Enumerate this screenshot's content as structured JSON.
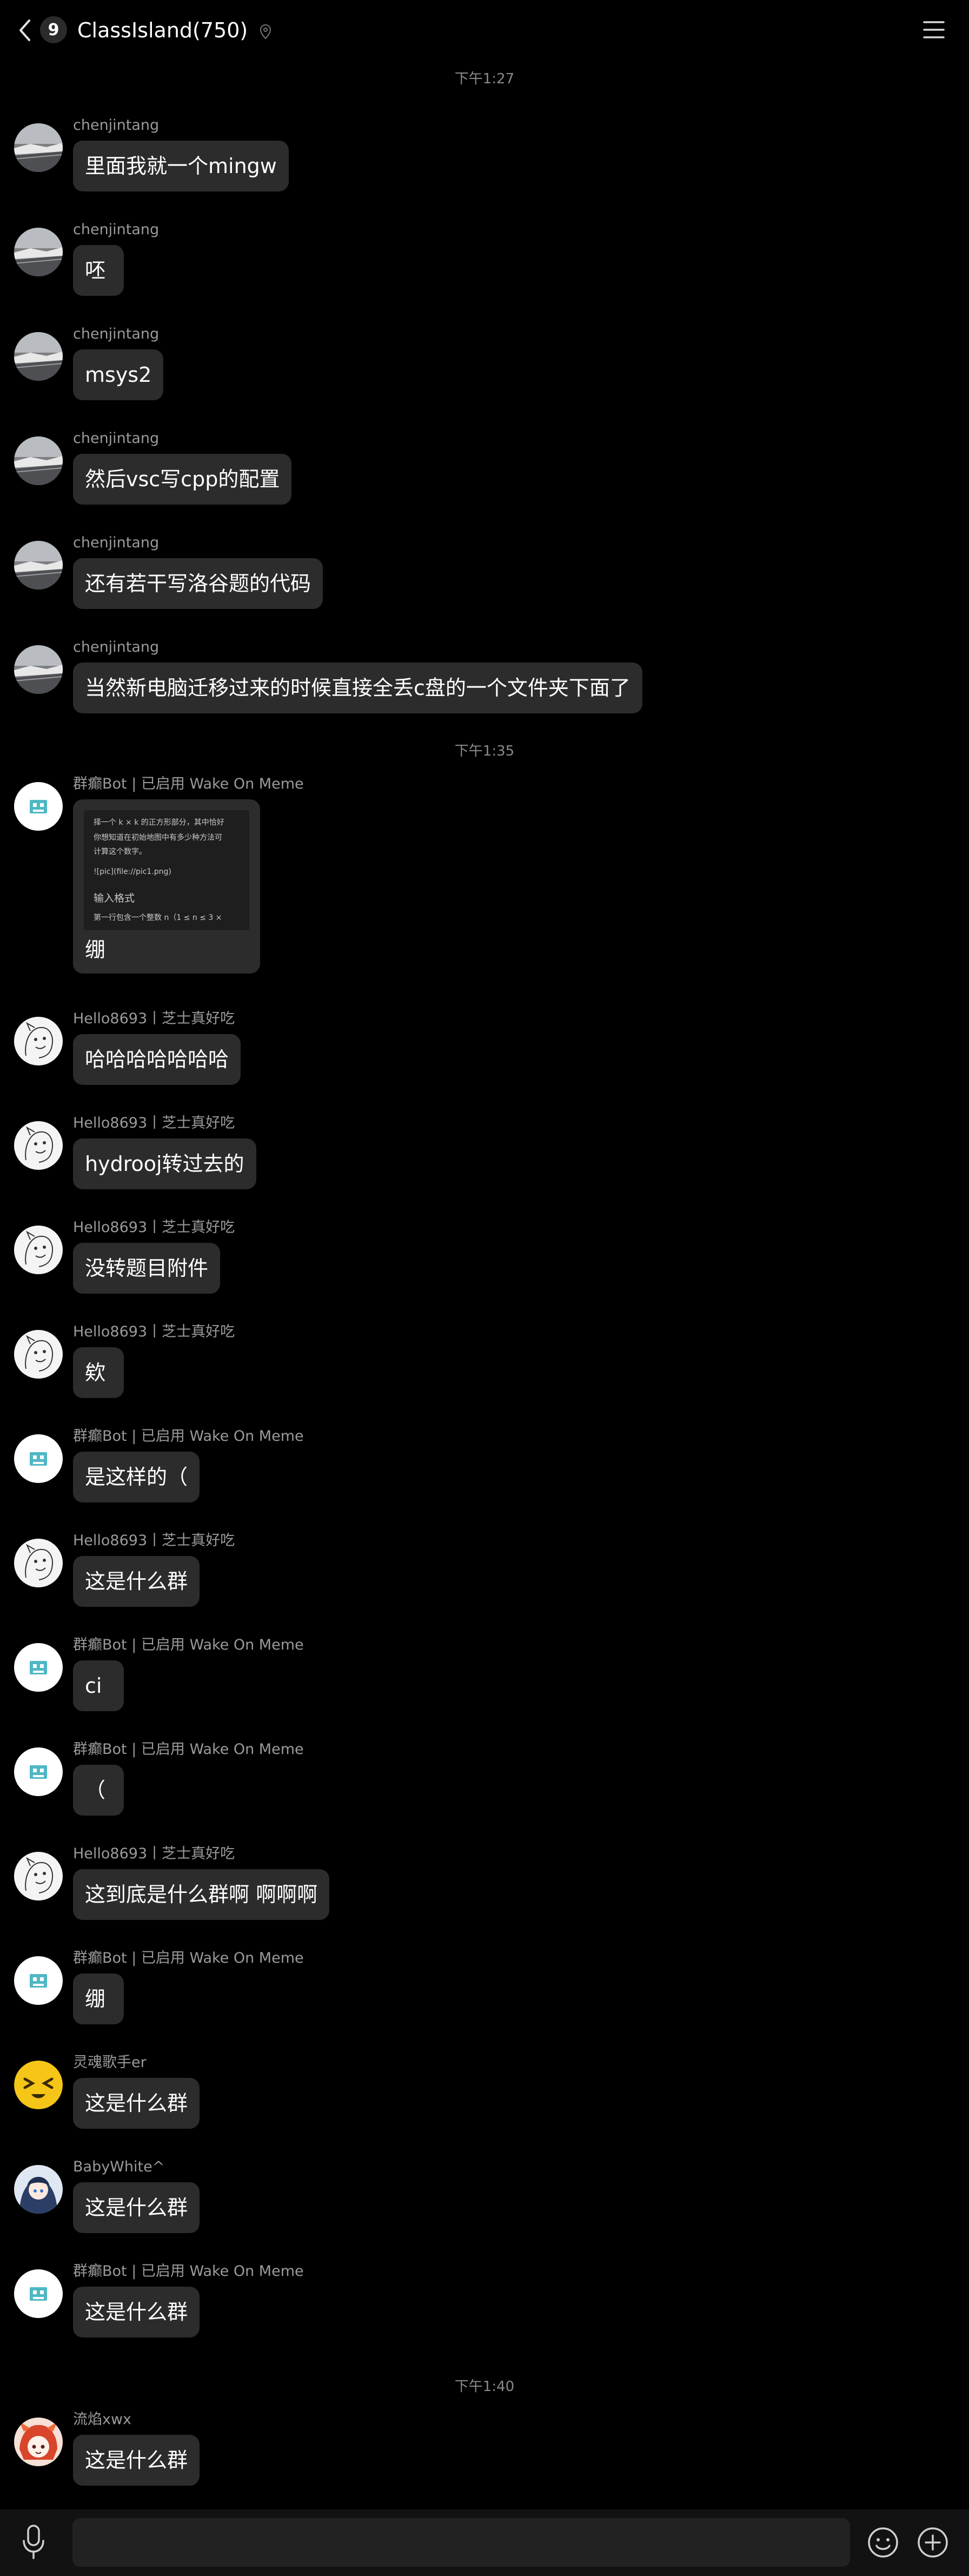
{
  "header": {
    "unread_count": "9",
    "title": "ClassIsland(750)"
  },
  "colors": {
    "background": "#000000",
    "bubble": "#2c2c2c",
    "sender_text": "#9a9a9a",
    "bot_avatar_accent": "#4fb8c4"
  },
  "chat": {
    "timestamps": [
      "下午1:27",
      "下午1:35",
      "下午1:40"
    ],
    "messages": [
      {
        "sender": "chenjintang",
        "text": "里面我就一个mingw",
        "avatar": "landscape-avatar"
      },
      {
        "sender": "chenjintang",
        "text": "呸",
        "avatar": "landscape-avatar"
      },
      {
        "sender": "chenjintang",
        "text": "msys2",
        "avatar": "landscape-avatar"
      },
      {
        "sender": "chenjintang",
        "text": "然后vsc写cpp的配置",
        "avatar": "landscape-avatar"
      },
      {
        "sender": "chenjintang",
        "text": "还有若干写洛谷题的代码",
        "avatar": "landscape-avatar"
      },
      {
        "sender": "chenjintang",
        "text": "当然新电脑迁移过来的时候直接全丢c盘的一个文件夹下面了",
        "avatar": "landscape-avatar"
      },
      {
        "sender": "群癫Bot | 已启用 Wake On Meme",
        "text": "绷",
        "avatar": "bot-avatar",
        "image": {
          "lines": [
            "择一个 k × k 的正方形部分，其中恰好",
            "你想知道在初始地图中有多少种方法可",
            "计算这个数字。",
            "![pic](file://pic1.png)",
            "输入格式",
            "第一行包含一个整数 n（1 ≤ n ≤ 3 ×"
          ]
        }
      },
      {
        "sender": "Hello8693丨芝士真好吃",
        "text": "哈哈哈哈哈哈哈",
        "avatar": "sketch-avatar"
      },
      {
        "sender": "Hello8693丨芝士真好吃",
        "text": "hydrooj转过去的",
        "avatar": "sketch-avatar"
      },
      {
        "sender": "Hello8693丨芝士真好吃",
        "text": "没转题目附件",
        "avatar": "sketch-avatar"
      },
      {
        "sender": "Hello8693丨芝士真好吃",
        "text": "欸",
        "avatar": "sketch-avatar"
      },
      {
        "sender": "群癫Bot | 已启用 Wake On Meme",
        "text": "是这样的（",
        "avatar": "bot-avatar"
      },
      {
        "sender": "Hello8693丨芝士真好吃",
        "text": "这是什么群",
        "avatar": "sketch-avatar"
      },
      {
        "sender": "群癫Bot | 已启用 Wake On Meme",
        "text": "ci",
        "avatar": "bot-avatar"
      },
      {
        "sender": "群癫Bot | 已启用 Wake On Meme",
        "text": "（",
        "avatar": "bot-avatar"
      },
      {
        "sender": "Hello8693丨芝士真好吃",
        "text": "这到底是什么群啊 啊啊啊",
        "avatar": "sketch-avatar"
      },
      {
        "sender": "群癫Bot | 已启用 Wake On Meme",
        "text": "绷",
        "avatar": "bot-avatar"
      },
      {
        "sender": "灵魂歌手er",
        "text": "这是什么群",
        "avatar": "yellow-face-avatar"
      },
      {
        "sender": "BabyWhite^",
        "text": "这是什么群",
        "avatar": "anime-avatar"
      },
      {
        "sender": "群癫Bot | 已启用 Wake On Meme",
        "text": "这是什么群",
        "avatar": "bot-avatar"
      },
      {
        "sender": "流焰xwx",
        "text": "这是什么群",
        "avatar": "red-character-avatar"
      }
    ]
  },
  "input_bar": {
    "mic_icon": "microphone-icon",
    "emoji_icon": "smiley-icon",
    "plus_icon": "plus-circle-icon"
  }
}
